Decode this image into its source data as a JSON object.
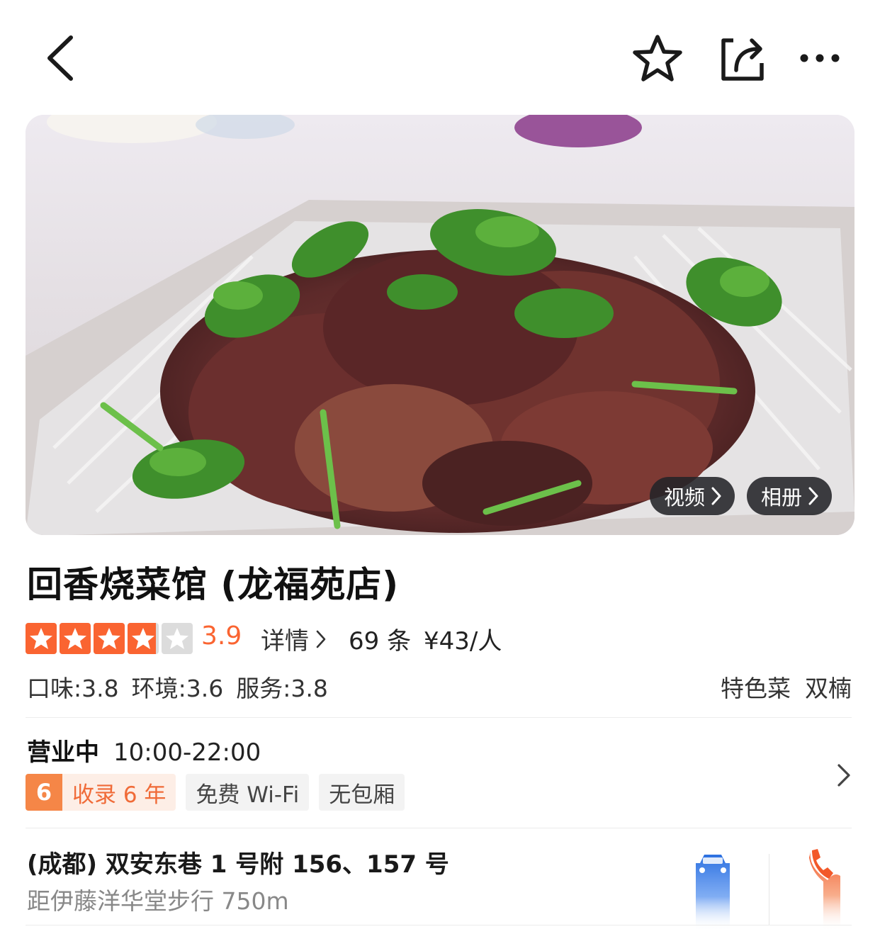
{
  "header": {
    "icons": [
      "back-arrow-icon",
      "star-favorite-icon",
      "share-icon",
      "more-icon"
    ]
  },
  "gallery": {
    "video_label": "视频",
    "album_label": "相册"
  },
  "shop": {
    "name": "回香烧菜馆 (龙福苑店)",
    "rating": 3.9,
    "rating_text": "3.9",
    "detail_label": "详情",
    "review_count": "69 条",
    "price_per_person": "¥43/人",
    "sub_scores": [
      {
        "text": "口味:3.8"
      },
      {
        "text": "环境:3.6"
      },
      {
        "text": "服务:3.8"
      }
    ],
    "tags": [
      "特色菜",
      "双楠"
    ]
  },
  "business": {
    "status": "营业中",
    "hours": "10:00-22:00",
    "badge_number": "6",
    "badge_text": "收录 6 年",
    "features": [
      "免费 Wi-Fi",
      "无包厢"
    ]
  },
  "location": {
    "address": "(成都) 双安东巷 1 号附 156、157 号",
    "distance": "距伊藤洋华堂步行 750m"
  },
  "colors": {
    "accent": "#fa6431",
    "car_blue": "#2b6fe0",
    "phone_orange": "#f2592a"
  }
}
